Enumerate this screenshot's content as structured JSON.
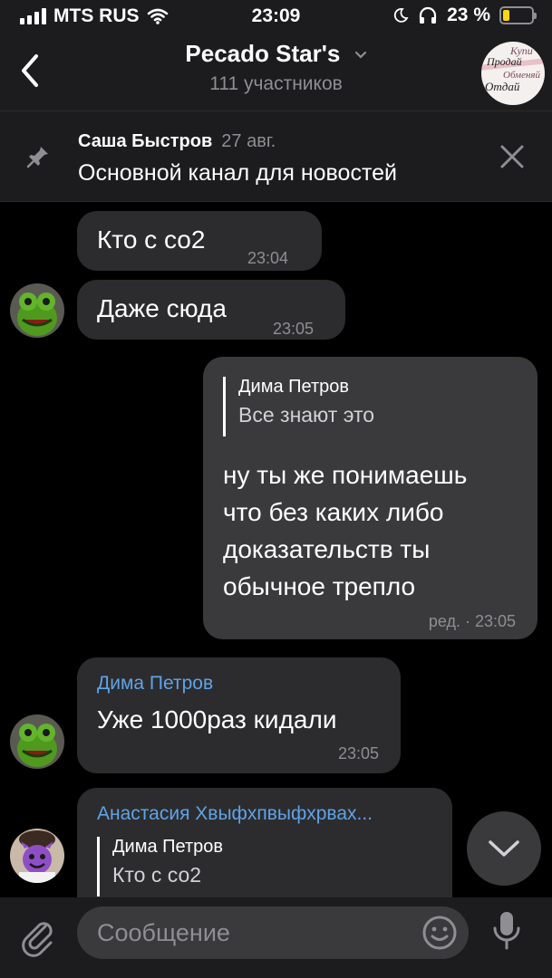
{
  "status_bar": {
    "carrier": "MTS RUS",
    "time": "23:09",
    "battery": "23 %",
    "battery_level": 0.23
  },
  "header": {
    "title": "Pecado Star's",
    "subtitle": "111 участников",
    "avatar_lines": [
      "Купи",
      "Продай",
      "Обменяй",
      "Отдай"
    ]
  },
  "pinned": {
    "author": "Саша Быстров",
    "date": "27 авг.",
    "text": "Основной канал для новостей"
  },
  "messages": [
    {
      "text": "Кто с со2",
      "time": "23:04"
    },
    {
      "text": "Даже сюда",
      "time": "23:05"
    },
    {
      "reply_name": "Дима Петров",
      "reply_text": "Все знают это",
      "text": "ну ты же понимаешь\nчто без каких либо\nдоказательств ты\nобычное трепло",
      "time": "ред. · 23:05"
    },
    {
      "sender": "Дима Петров",
      "text": "Уже 1000раз кидали",
      "time": "23:05"
    },
    {
      "sender": "Анастасия Хвыфхпвыфхрвах...",
      "reply_name": "Дима Петров",
      "reply_text": "Кто с со2"
    }
  ],
  "input": {
    "placeholder": "Сообщение"
  },
  "colors": {
    "accent": "#5fa3e8",
    "bubble": "#2c2c2e",
    "bubble_out": "#3a3a3c",
    "battery": "#ffd60a"
  }
}
